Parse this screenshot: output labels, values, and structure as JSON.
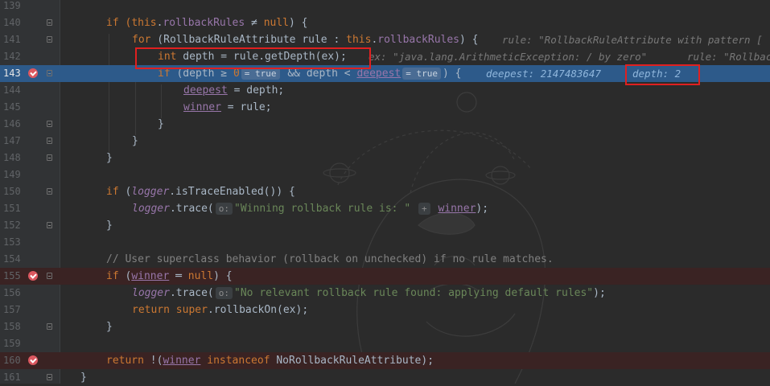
{
  "lines": [
    {
      "num": "139"
    },
    {
      "num": "140"
    },
    {
      "num": "141"
    },
    {
      "num": "142"
    },
    {
      "num": "143"
    },
    {
      "num": "144"
    },
    {
      "num": "145"
    },
    {
      "num": "146"
    },
    {
      "num": "147"
    },
    {
      "num": "148"
    },
    {
      "num": "149"
    },
    {
      "num": "150"
    },
    {
      "num": "151"
    },
    {
      "num": "152"
    },
    {
      "num": "153"
    },
    {
      "num": "154"
    },
    {
      "num": "155"
    },
    {
      "num": "156"
    },
    {
      "num": "157"
    },
    {
      "num": "158"
    },
    {
      "num": "159"
    },
    {
      "num": "160"
    },
    {
      "num": "161"
    }
  ],
  "code": {
    "l140": {
      "a": "if (",
      "b": "this",
      "c": ".",
      "d": "rollbackRules",
      "e": " ≠ ",
      "f": "null",
      "g": ") {"
    },
    "l141": {
      "a": "for",
      "b": " (RollbackRuleAttribute rule : ",
      "c": "this",
      "d": ".",
      "e": "rollbackRules",
      "f": ") {"
    },
    "l142": {
      "a": "int",
      "b": " depth = rule.getDepth(ex);"
    },
    "l143": {
      "a": "if",
      "b": " (depth ≥ ",
      "c": "0",
      "d": "= true",
      "e": " && depth < ",
      "f": "deepest",
      "g": "= true",
      "h": ") {"
    },
    "l144": {
      "a": "deepest",
      "b": " = depth;"
    },
    "l145": {
      "a": "winner",
      "b": " = rule;"
    },
    "l146": {
      "a": "}"
    },
    "l147": {
      "a": "}"
    },
    "l148": {
      "a": "}"
    },
    "l150": {
      "a": "if",
      "b": " (",
      "c": "logger",
      "d": ".isTraceEnabled()) {"
    },
    "l151": {
      "a": "logger",
      "b": ".trace(",
      "c": "o:",
      "d": "\"Winning rollback rule is: \"",
      "e": "+",
      "f": "winner",
      "g": ");"
    },
    "l152": {
      "a": "}"
    },
    "l154": {
      "a": "// User superclass behavior (rollback on unchecked) if no rule matches."
    },
    "l155": {
      "a": "if",
      "b": " (",
      "c": "winner",
      "d": " ═ ",
      "e": "null",
      "f": ") {"
    },
    "l156": {
      "a": "logger",
      "b": ".trace(",
      "c": "o:",
      "d": "\"No relevant rollback rule found: applying default rules\"",
      "e": ");"
    },
    "l157": {
      "a": "return",
      "b": " ",
      "c": "super",
      "d": ".rollbackOn(ex);"
    },
    "l158": {
      "a": "}"
    },
    "l160": {
      "a": "return",
      "b": " !(",
      "c": "winner",
      "d": " ",
      "e": "instanceof",
      "f": " NoRollbackRuleAttribute);"
    },
    "l161": {
      "a": "}"
    }
  },
  "debug": {
    "l141": "rule: \"RollbackRuleAttribute with pattern [",
    "l142_ex": "ex: \"java.lang.ArithmeticException: / by zero\"",
    "l142_rule": "rule: \"Rollbac",
    "l143_deepest": "deepest: 2147483647",
    "l143_depth": "depth: 2"
  },
  "colors": {
    "background": "#2b2b2b",
    "current_line": "#2d5a8a",
    "breakpoint": "#db5860",
    "annotation": "#e02020"
  }
}
